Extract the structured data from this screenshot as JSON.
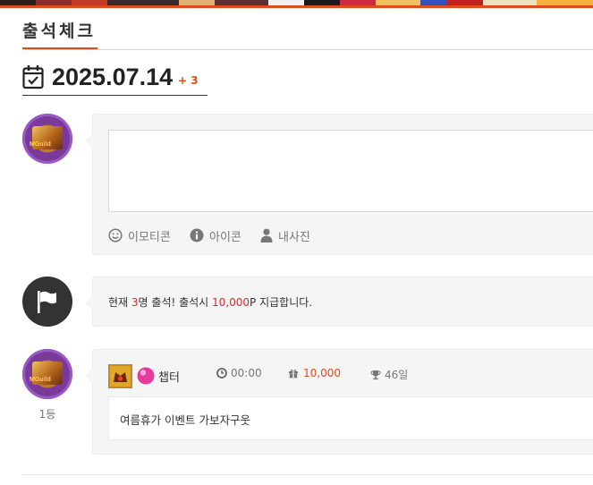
{
  "page": {
    "title": "출석체크",
    "date": "2025.07.14",
    "date_badge": "+ 3"
  },
  "comment_form": {
    "textarea_placeholder": "",
    "toolbar": [
      {
        "label": "이모티콘",
        "icon": "smiley-icon"
      },
      {
        "label": "아이콘",
        "icon": "info-icon"
      },
      {
        "label": "내사진",
        "icon": "person-icon"
      }
    ]
  },
  "notice": {
    "prefix": "현재 ",
    "count": "3",
    "middle": "명 출석! 출석시 ",
    "points": "10,000",
    "suffix": "P 지급합니다."
  },
  "entries": [
    {
      "rank": "1등",
      "nickname": "챕터",
      "time": "00:00",
      "points": "10,000",
      "days": "46일",
      "message": "여름휴가 이벤트 가보자구웃",
      "avatar_text": "MGuild"
    }
  ],
  "colors": {
    "accent": "#e04a1f",
    "points_red": "#e0262a",
    "bubble_bg": "#f5f5f5",
    "flag_circle": "#333333"
  }
}
